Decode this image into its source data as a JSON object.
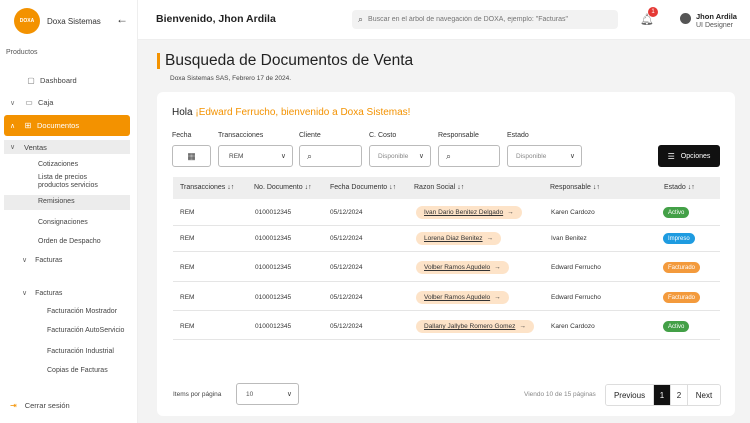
{
  "brand": {
    "logo_text": "DOXA",
    "name": "Doxa Sistemas"
  },
  "sidebar": {
    "section_label": "Productos",
    "dashboard": "Dashboard",
    "caja": "Caja",
    "documentos": "Documentos",
    "ventas": "Ventas",
    "ventas_items": [
      "Cotizaciones",
      "Lista de precios productos servicios",
      "Remisiones",
      "Consignaciones",
      "Orden de Despacho"
    ],
    "facturas_group_1": "Facturas",
    "facturas_group_2": "Facturas",
    "facturas_items": [
      "Facturación Mostrador",
      "Facturación AutoServicio",
      "Facturación Industrial",
      "Copias de Facturas"
    ],
    "logout": "Cerrar sesión"
  },
  "header": {
    "welcome": "Bienvenido, Jhon Ardila",
    "search_placeholder": "Buscar en el árbol de navegación de DOXA, ejemplo: \"Facturas\"",
    "notification_count": "1",
    "user_name": "Jhon Ardila",
    "user_role": "UI Designer"
  },
  "page": {
    "title": "Busqueda de Documentos de Venta",
    "subtitle": "Doxa Sistemas SAS, Febrero 17 de 2024."
  },
  "greeting": {
    "prefix": "Hola ",
    "highlight": "¡Edward Ferrucho, bienvenido a Doxa Sistemas!"
  },
  "filters": {
    "fecha_label": "Fecha",
    "transacciones_label": "Transacciones",
    "transacciones_value": "REM",
    "cliente_label": "Cliente",
    "ccosto_label": "C. Costo",
    "ccosto_value": "Disponible",
    "responsable_label": "Responsable",
    "estado_label": "Estado",
    "estado_value": "Disponible",
    "options_button": "Opciones"
  },
  "table": {
    "headers": [
      "Transacciones",
      "No. Documento",
      "Fecha Documento",
      "Razon Social",
      "Responsable",
      "Estado"
    ],
    "rows": [
      {
        "trans": "REM",
        "doc": "0100012345",
        "fecha": "05/12/2024",
        "razon": "Ivan Dario Benitez Delgado",
        "resp": "Karen Cardozo",
        "estado": "Activo"
      },
      {
        "trans": "REM",
        "doc": "0100012345",
        "fecha": "05/12/2024",
        "razon": "Lorena Diaz Benitez",
        "resp": "Ivan Benitez",
        "estado": "Impreso"
      },
      {
        "trans": "REM",
        "doc": "0100012345",
        "fecha": "05/12/2024",
        "razon": "Volber Ramos Agudelo",
        "resp": "Edward Ferrucho",
        "estado": "Facturado"
      },
      {
        "trans": "REM",
        "doc": "0100012345",
        "fecha": "05/12/2024",
        "razon": "Volber Ramos Agudelo",
        "resp": "Edward Ferrucho",
        "estado": "Facturado"
      },
      {
        "trans": "REM",
        "doc": "0100012345",
        "fecha": "05/12/2024",
        "razon": "Dallany Jallybe Romero Gomez",
        "resp": "Karen Cardozo",
        "estado": "Activo"
      }
    ]
  },
  "status_colors": {
    "Activo": "#43a047",
    "Impreso": "#1e9be0",
    "Facturado": "#f39a3c"
  },
  "footer": {
    "items_per_page_label": "Items por página",
    "items_per_page_value": "10",
    "view_info": "Viendo 10 de 15 páginas",
    "prev": "Previous",
    "pages": [
      "1",
      "2"
    ],
    "next": "Next"
  }
}
